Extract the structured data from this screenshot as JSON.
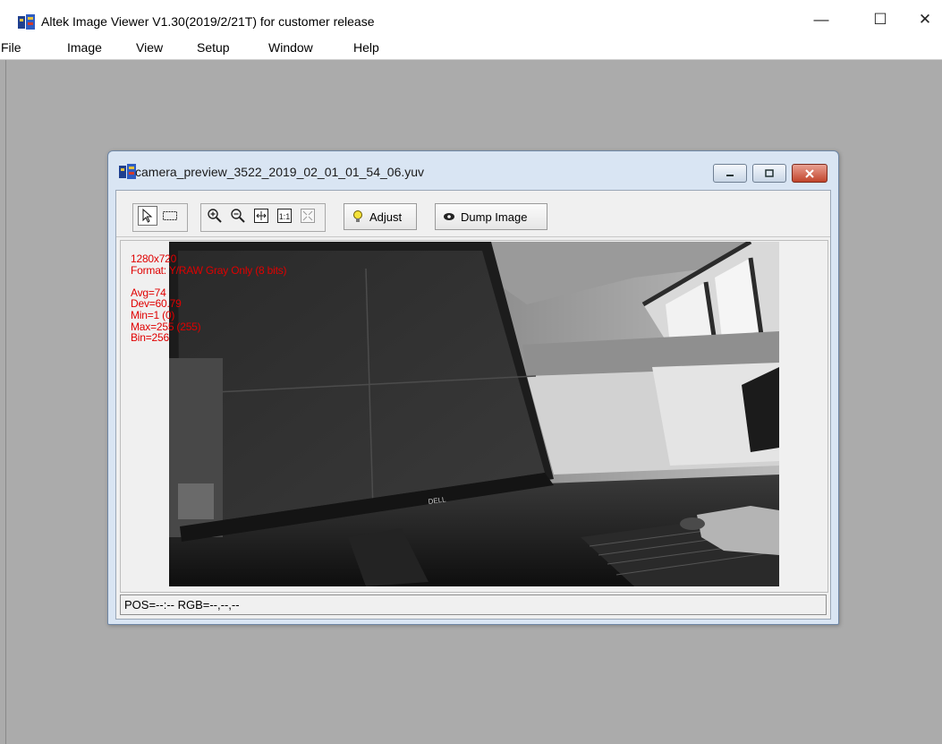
{
  "app": {
    "title": "Altek Image Viewer V1.30(2019/2/21T)  for customer release",
    "icon": "altek-app-icon",
    "window_controls": {
      "minimize": "—",
      "maximize": "☐",
      "close": "✕"
    }
  },
  "menu": {
    "items": [
      "File",
      "Image",
      "View",
      "Setup",
      "Window",
      "Help"
    ]
  },
  "child_window": {
    "title": "camera_preview_3522_2019_02_01_01_54_06.yuv",
    "icon": "altek-app-icon",
    "controls": [
      "minimize",
      "restore",
      "close"
    ]
  },
  "toolbar": {
    "tools": [
      "pointer-icon",
      "select-rect-icon"
    ],
    "zoom_tools": [
      "zoom-in-icon",
      "zoom-out-icon",
      "fit-window-icon",
      "actual-size-icon",
      "fullscreen-icon"
    ],
    "actual_size_label": "1:1",
    "adjust_label": "Adjust",
    "dump_label": "Dump Image",
    "adjust_icon": "lightbulb-icon",
    "dump_icon": "eye-icon"
  },
  "image_info": {
    "resolution": "1280x720",
    "format": "Format: Y/RAW Gray Only (8 bits)",
    "avg": "Avg=74",
    "dev": "Dev=60.79",
    "min": "Min=1 (0)",
    "max": "Max=255 (255)",
    "bin": "Bin=256"
  },
  "image": {
    "brand_text": "DELL",
    "description_colors": {
      "accent_text": "#e00000"
    }
  },
  "status": {
    "text": "POS=--:--  RGB=--,--,--"
  }
}
